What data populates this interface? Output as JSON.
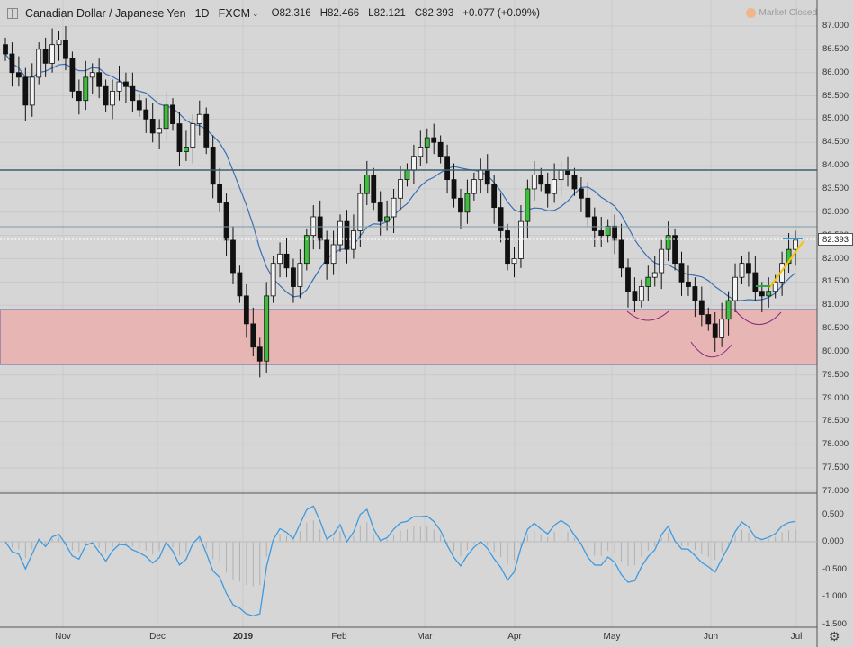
{
  "header": {
    "symbol": "Canadian Dollar / Japanese Yen",
    "timeframe": "1D",
    "exchange": "FXCM",
    "open": "O82.316",
    "high": "H82.466",
    "low": "L82.121",
    "close": "C82.393",
    "change": "+0.077 (+0.09%)",
    "market_status": "Market Closed"
  },
  "price_axis": {
    "labels": [
      "87.000",
      "86.500",
      "86.000",
      "85.500",
      "85.000",
      "84.500",
      "84.000",
      "83.500",
      "83.000",
      "82.500",
      "82.000",
      "81.500",
      "81.000",
      "80.500",
      "80.000",
      "79.500",
      "79.000",
      "78.500",
      "78.000",
      "77.500",
      "77.000"
    ],
    "current_price": "82.393"
  },
  "oscillator_axis": {
    "labels": [
      "0.500",
      "0.000",
      "-0.500",
      "-1.000",
      "-1.500"
    ]
  },
  "time_axis": {
    "labels": [
      {
        "text": "Nov",
        "bold": false
      },
      {
        "text": "Dec",
        "bold": false
      },
      {
        "text": "2019",
        "bold": true
      },
      {
        "text": "Feb",
        "bold": false
      },
      {
        "text": "Mar",
        "bold": false
      },
      {
        "text": "Apr",
        "bold": false
      },
      {
        "text": "May",
        "bold": false
      },
      {
        "text": "Jun",
        "bold": false
      },
      {
        "text": "Jul",
        "bold": false
      }
    ]
  },
  "chart_data": {
    "type": "candlestick",
    "title": "Canadian Dollar / Japanese Yen 1D FXCM",
    "ylim": [
      77.0,
      87.0
    ],
    "oscillator_ylim": [
      -1.5,
      0.8
    ],
    "resistance_lines": [
      83.9,
      82.65
    ],
    "support_zone": [
      79.75,
      80.9
    ],
    "colors": {
      "up": "#3dbf3d",
      "down": "#111111",
      "ma": "#3a6fb5",
      "oscillator": "#3d9ae0",
      "zone": "#e8b4b4",
      "resistance": "#3f5f6e",
      "trend": "#f5c400"
    },
    "approx_closes": [
      86.4,
      86.0,
      85.9,
      85.3,
      85.9,
      86.5,
      86.2,
      86.6,
      86.7,
      86.3,
      85.6,
      85.4,
      85.9,
      86.0,
      85.7,
      85.3,
      85.6,
      85.8,
      85.7,
      85.4,
      85.2,
      85.0,
      84.7,
      84.8,
      85.3,
      84.9,
      84.3,
      84.4,
      84.9,
      85.1,
      84.4,
      83.6,
      83.2,
      82.4,
      81.7,
      81.2,
      80.6,
      80.1,
      79.8,
      81.2,
      81.9,
      82.1,
      81.8,
      81.4,
      81.9,
      82.5,
      82.9,
      82.4,
      81.9,
      82.3,
      82.8,
      82.2,
      82.6,
      83.4,
      83.8,
      83.2,
      82.8,
      82.9,
      83.3,
      83.7,
      83.9,
      84.2,
      84.4,
      84.6,
      84.5,
      84.2,
      83.7,
      83.3,
      83.0,
      83.4,
      83.7,
      83.9,
      83.6,
      83.1,
      82.6,
      81.9,
      82.0,
      82.8,
      83.5,
      83.8,
      83.6,
      83.4,
      83.7,
      83.9,
      83.8,
      83.5,
      83.3,
      82.9,
      82.6,
      82.5,
      82.7,
      82.4,
      81.8,
      81.3,
      81.1,
      81.4,
      81.6,
      81.7,
      82.2,
      82.5,
      81.9,
      81.5,
      81.4,
      81.1,
      80.8,
      80.6,
      80.3,
      80.7,
      81.1,
      81.6,
      81.9,
      81.7,
      81.3,
      81.2,
      81.3,
      81.5,
      81.9,
      82.2,
      82.4
    ]
  }
}
